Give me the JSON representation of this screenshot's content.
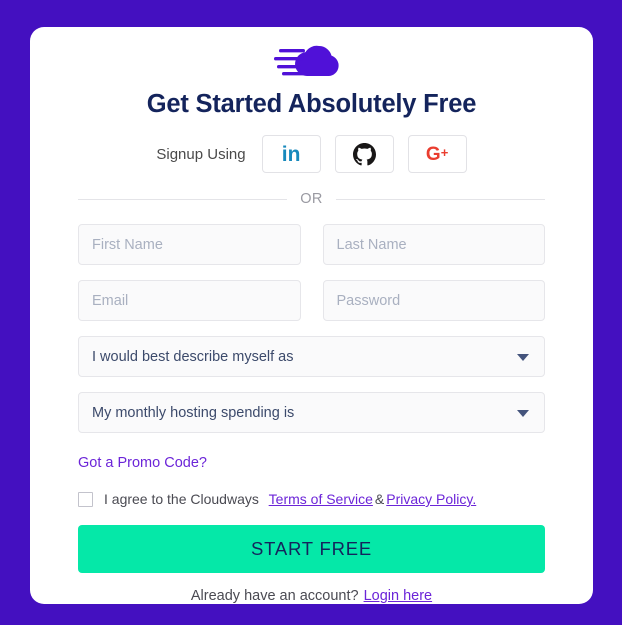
{
  "theme": {
    "page_background": "#4410C0",
    "card_background": "#FFFFFF",
    "heading_color": "#14245C",
    "link_color": "#6C25D8",
    "cta_background": "#05E8A8",
    "cta_text_color": "#14245C",
    "input_background": "#FAFAFB",
    "linkedin_color": "#1789BC",
    "github_color": "#191717",
    "googleplus_color": "#EA3D2F"
  },
  "logo": {
    "name": "cloudways-cloud-logo",
    "color": "#5011D8"
  },
  "heading": "Get Started Absolutely Free",
  "social": {
    "label": "Signup Using",
    "buttons": [
      {
        "name": "linkedin",
        "glyph": "in"
      },
      {
        "name": "github",
        "glyph": "github-mark"
      },
      {
        "name": "google-plus",
        "glyph": "G",
        "suffix": "+"
      }
    ]
  },
  "divider": {
    "text": "OR"
  },
  "form": {
    "first_name": {
      "placeholder": "First Name",
      "value": ""
    },
    "last_name": {
      "placeholder": "Last Name",
      "value": ""
    },
    "email": {
      "placeholder": "Email",
      "value": ""
    },
    "password": {
      "placeholder": "Password",
      "value": ""
    },
    "role_select": {
      "selected": "I would best describe myself as"
    },
    "spending_select": {
      "selected": "My monthly hosting spending is"
    },
    "promo_link": "Got a Promo Code?",
    "terms": {
      "checked": false,
      "prefix": "I agree to the Cloudways",
      "terms_link": "Terms of Service",
      "separator": "&",
      "privacy_link": "Privacy Policy."
    },
    "submit_label": "START FREE"
  },
  "footer": {
    "text": "Already have an account?",
    "login_link": "Login here"
  }
}
